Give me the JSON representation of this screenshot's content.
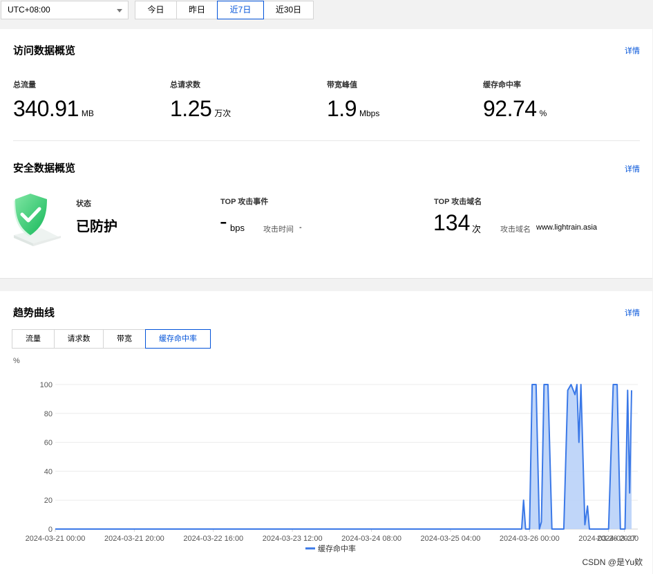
{
  "toolbar": {
    "timezone": "UTC+08:00",
    "ranges": [
      "今日",
      "昨日",
      "近7日",
      "近30日"
    ],
    "active_range": "近7日"
  },
  "access_overview": {
    "title": "访问数据概览",
    "detail": "详情",
    "metrics": [
      {
        "label": "总流量",
        "value": "340.91",
        "unit": "MB"
      },
      {
        "label": "总请求数",
        "value": "1.25",
        "unit": "万次"
      },
      {
        "label": "带宽峰值",
        "value": "1.9",
        "unit": "Mbps"
      },
      {
        "label": "缓存命中率",
        "value": "92.74",
        "unit": "%"
      }
    ]
  },
  "security_overview": {
    "title": "安全数据概览",
    "detail": "详情",
    "status_label": "状态",
    "status_value": "已防护",
    "top_event_label": "TOP 攻击事件",
    "top_event_value": "-",
    "top_event_unit": "bps",
    "attack_time_label": "攻击时间",
    "attack_time_value": "-",
    "top_domain_label": "TOP 攻击域名",
    "top_domain_value": "134",
    "top_domain_unit": "次",
    "attack_domain_label": "攻击域名",
    "attack_domain_value": "www.lightrain.asia"
  },
  "trend": {
    "title": "趋势曲线",
    "detail": "详情",
    "tabs": [
      "流量",
      "请求数",
      "带宽",
      "缓存命中率"
    ],
    "active_tab": "缓存命中率"
  },
  "chart_data": {
    "type": "area",
    "ylabel": "%",
    "ylim": [
      0,
      100
    ],
    "yticks": [
      0,
      20,
      40,
      60,
      80,
      100
    ],
    "xlim": [
      "2024-03-21 00:00",
      "2024-03-27 02:00"
    ],
    "xtick_labels": [
      "2024-03-21 00:00",
      "2024-03-21 20:00",
      "2024-03-22 16:00",
      "2024-03-23 12:00",
      "2024-03-24 08:00",
      "2024-03-25 04:00",
      "2024-03-26 00:00",
      "2024-03-26 20:00",
      "2024-03-27"
    ],
    "grid": true,
    "legend_position": "bottom",
    "series": [
      {
        "name": "缓存命中率",
        "color": "#3a78e7",
        "fill": "#b9d2f8",
        "points": [
          [
            "2024-03-21 00:00",
            0
          ],
          [
            "2024-03-25 22:00",
            0
          ],
          [
            "2024-03-25 22:30",
            20
          ],
          [
            "2024-03-25 23:00",
            0
          ],
          [
            "2024-03-26 00:00",
            0
          ],
          [
            "2024-03-26 00:40",
            100
          ],
          [
            "2024-03-26 01:40",
            100
          ],
          [
            "2024-03-26 02:30",
            0
          ],
          [
            "2024-03-26 03:00",
            5
          ],
          [
            "2024-03-26 03:40",
            100
          ],
          [
            "2024-03-26 04:40",
            100
          ],
          [
            "2024-03-26 05:40",
            0
          ],
          [
            "2024-03-26 08:00",
            0
          ],
          [
            "2024-03-26 08:40",
            0
          ],
          [
            "2024-03-26 09:40",
            96
          ],
          [
            "2024-03-26 10:30",
            100
          ],
          [
            "2024-03-26 11:30",
            93
          ],
          [
            "2024-03-26 12:00",
            100
          ],
          [
            "2024-03-26 12:30",
            60
          ],
          [
            "2024-03-26 13:00",
            100
          ],
          [
            "2024-03-26 14:00",
            3
          ],
          [
            "2024-03-26 14:40",
            16
          ],
          [
            "2024-03-26 15:10",
            0
          ],
          [
            "2024-03-26 20:00",
            0
          ],
          [
            "2024-03-26 21:10",
            100
          ],
          [
            "2024-03-26 22:10",
            100
          ],
          [
            "2024-03-26 23:00",
            0
          ],
          [
            "2024-03-27 00:10",
            0
          ],
          [
            "2024-03-27 00:50",
            96
          ],
          [
            "2024-03-27 01:20",
            25
          ],
          [
            "2024-03-27 01:50",
            96
          ]
        ]
      }
    ]
  },
  "watermark": "CSDN @是Yu欸"
}
